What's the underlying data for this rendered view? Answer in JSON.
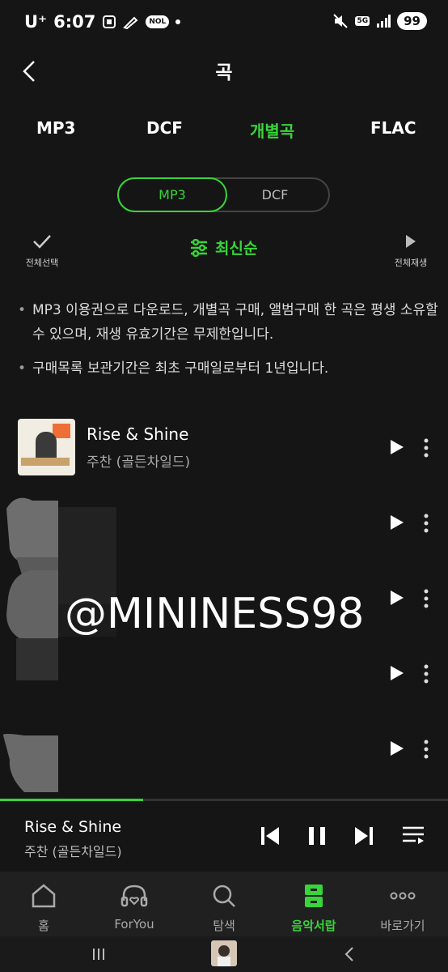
{
  "status": {
    "carrier": "U⁺",
    "time": "6:07",
    "nol": "NOL",
    "network": "5G",
    "battery": "99"
  },
  "header": {
    "title": "곡"
  },
  "format_tabs": [
    {
      "label": "MP3"
    },
    {
      "label": "DCF"
    },
    {
      "label": "개별곡",
      "active": true
    },
    {
      "label": "FLAC"
    }
  ],
  "segment": {
    "options": [
      "MP3",
      "DCF"
    ],
    "selected": "MP3"
  },
  "toolbar": {
    "select_all": "전체선택",
    "sort": "최신순",
    "play_all": "전체재생"
  },
  "notices": [
    "MP3 이용권으로 다운로드, 개별곡 구매, 앨범구매 한 곡은 평생 소유할 수 있으며, 재생 유효기간은 무제한입니다.",
    "구매목록 보관기간은 최초 구매일로부터 1년입니다."
  ],
  "tracks": [
    {
      "title": "Rise & Shine",
      "artist": "주찬 (골든차일드)"
    },
    {
      "title": "",
      "artist": ""
    },
    {
      "title": "",
      "artist": ""
    },
    {
      "title": "",
      "artist": ""
    },
    {
      "title": "",
      "artist": ""
    }
  ],
  "watermark": "@MININESS98",
  "player": {
    "title": "Rise & Shine",
    "artist": "주찬 (골든차일드)",
    "progress": 0.32
  },
  "bottom_nav": [
    {
      "label": "홈",
      "icon": "home-icon"
    },
    {
      "label": "ForYou",
      "icon": "headphones-heart-icon"
    },
    {
      "label": "탐색",
      "icon": "search-icon"
    },
    {
      "label": "음악서랍",
      "icon": "drawer-icon",
      "active": true
    },
    {
      "label": "바로가기",
      "icon": "more-dots-icon"
    }
  ],
  "colors": {
    "accent": "#39d43a",
    "background": "#151515"
  }
}
